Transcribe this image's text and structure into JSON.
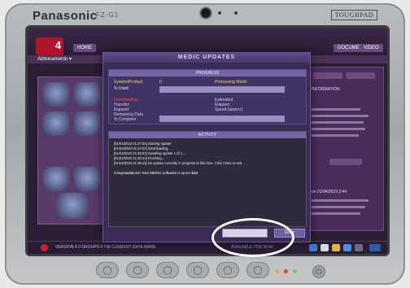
{
  "device": {
    "brand": "Panasonic",
    "model": "FZ-G1",
    "badge": "TOUGHPAD",
    "hw_buttons": [
      "◯",
      "◯",
      "◯",
      "◯",
      "◯",
      "◯"
    ],
    "power_glyph": "⏻"
  },
  "app": {
    "logo_number": "4",
    "nav": {
      "home": "HOME",
      "documents": "DOCUMENT",
      "video": "VIDEO"
    },
    "subbar_label": "Abbonamento ▾"
  },
  "modal": {
    "title": "MEDIC UPDATES",
    "progress_header": "PROGRESS",
    "row1_status_label": "System/Product",
    "row1_value": "0",
    "row1_state": "Processing Wizkit",
    "row2_label": "% Used",
    "section2_red": "Downloading",
    "row3_label": "Transfer",
    "row3_value": "Estimated",
    "row4_label": "Elapsed",
    "row4_value": "Elapsed",
    "row5_label": "Remaining Data",
    "row5_value": "Speed (approx)",
    "row6_label": "% Complete",
    "progress1": 1.0,
    "progress2": 1.0,
    "activity_header": "ACTIVITY",
    "log": [
      "[01/04/2023 01:27:53] Starting update",
      "[01/04/2023 01:27:53] Downloading...",
      "[01/04/2023 01:28:02] Installing update 1 of 1 ...",
      "[01/04/2023 01:28:10] Finishing...",
      "[01/04/2023 01:28:11] No update currently in progress at this time. Click Close to exit."
    ],
    "completion_text": "Congratulations! Your MEDIC software is up-to-date.",
    "close_label": "Close"
  },
  "footer": {
    "left_text": "VERSION  4.0      GROUPS 4      738      CURRENT DATA WARE",
    "right_text": "AVAILABLE FOR NOW"
  },
  "right_panel": {
    "title": "INFORMATION",
    "date_label": "on 01/04/2023",
    "time": "2:44"
  },
  "colors": {
    "accent": "#b1142a",
    "modal_bg": "#3a2c56",
    "ring": "#ffffff"
  }
}
